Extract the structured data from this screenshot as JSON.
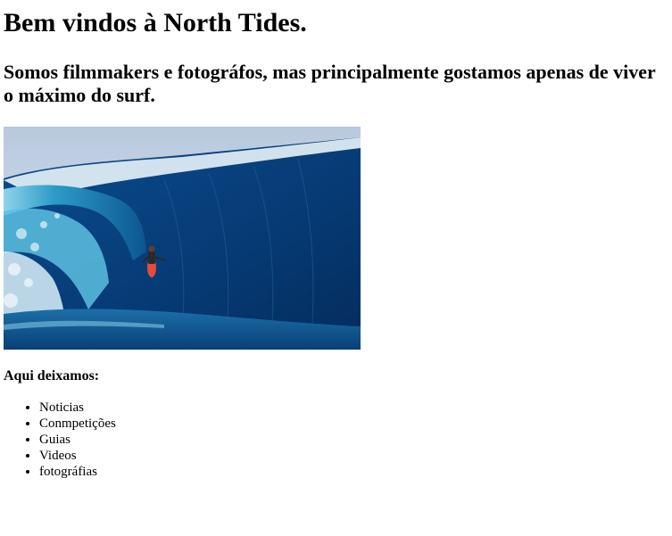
{
  "page": {
    "heading": "Bem vindos à North Tides.",
    "subheading": "Somos filmmakers e fotográfos, mas principalmente gostamos apenas de viver o máximo do surf.",
    "section_title": "Aqui deixamos:",
    "list_items": [
      "Noticias",
      "Conmpetições",
      "Guias",
      "Videos",
      "fotográfias"
    ]
  },
  "image": {
    "subject": "surfer-riding-barrel-wave",
    "colors": {
      "sky": "#c9d6e6",
      "wave_deep": "#0a3d7a",
      "wave_light": "#4fb6d8",
      "foam": "#e8f4fa",
      "surfboard": "#e84a3a"
    }
  }
}
